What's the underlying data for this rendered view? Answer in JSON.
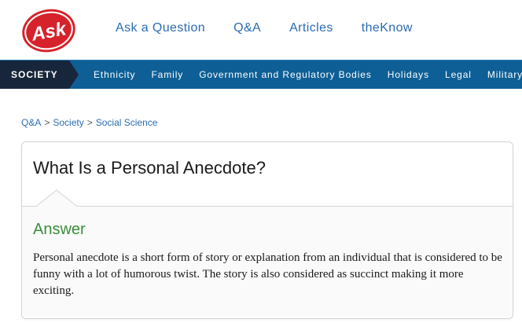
{
  "brand": {
    "logo_text": "Ask",
    "logo_color": "#d6222a"
  },
  "top_nav": {
    "items": [
      {
        "label": "Ask a Question"
      },
      {
        "label": "Q&A"
      },
      {
        "label": "Articles"
      },
      {
        "label": "theKnow"
      }
    ]
  },
  "category_bar": {
    "current": "SOCIETY",
    "items": [
      {
        "label": "Ethnicity"
      },
      {
        "label": "Family"
      },
      {
        "label": "Government and Regulatory Bodies"
      },
      {
        "label": "Holidays"
      },
      {
        "label": "Legal"
      },
      {
        "label": "Military"
      }
    ]
  },
  "breadcrumb": {
    "items": [
      {
        "label": "Q&A"
      },
      {
        "label": "Society"
      },
      {
        "label": "Social Science"
      }
    ],
    "separator": ">"
  },
  "question": {
    "title": "What Is a Personal Anecdote?"
  },
  "answer": {
    "heading": "Answer",
    "text": "Personal anecdote is a short form of story or explanation from an individual that is considered to be funny with a lot of humorous twist. The story is also considered as succinct making it more exciting."
  },
  "colors": {
    "link": "#2a6cb0",
    "category_bar": "#0d5f96",
    "category_current": "#17263a",
    "answer_heading": "#3a8e3a"
  }
}
